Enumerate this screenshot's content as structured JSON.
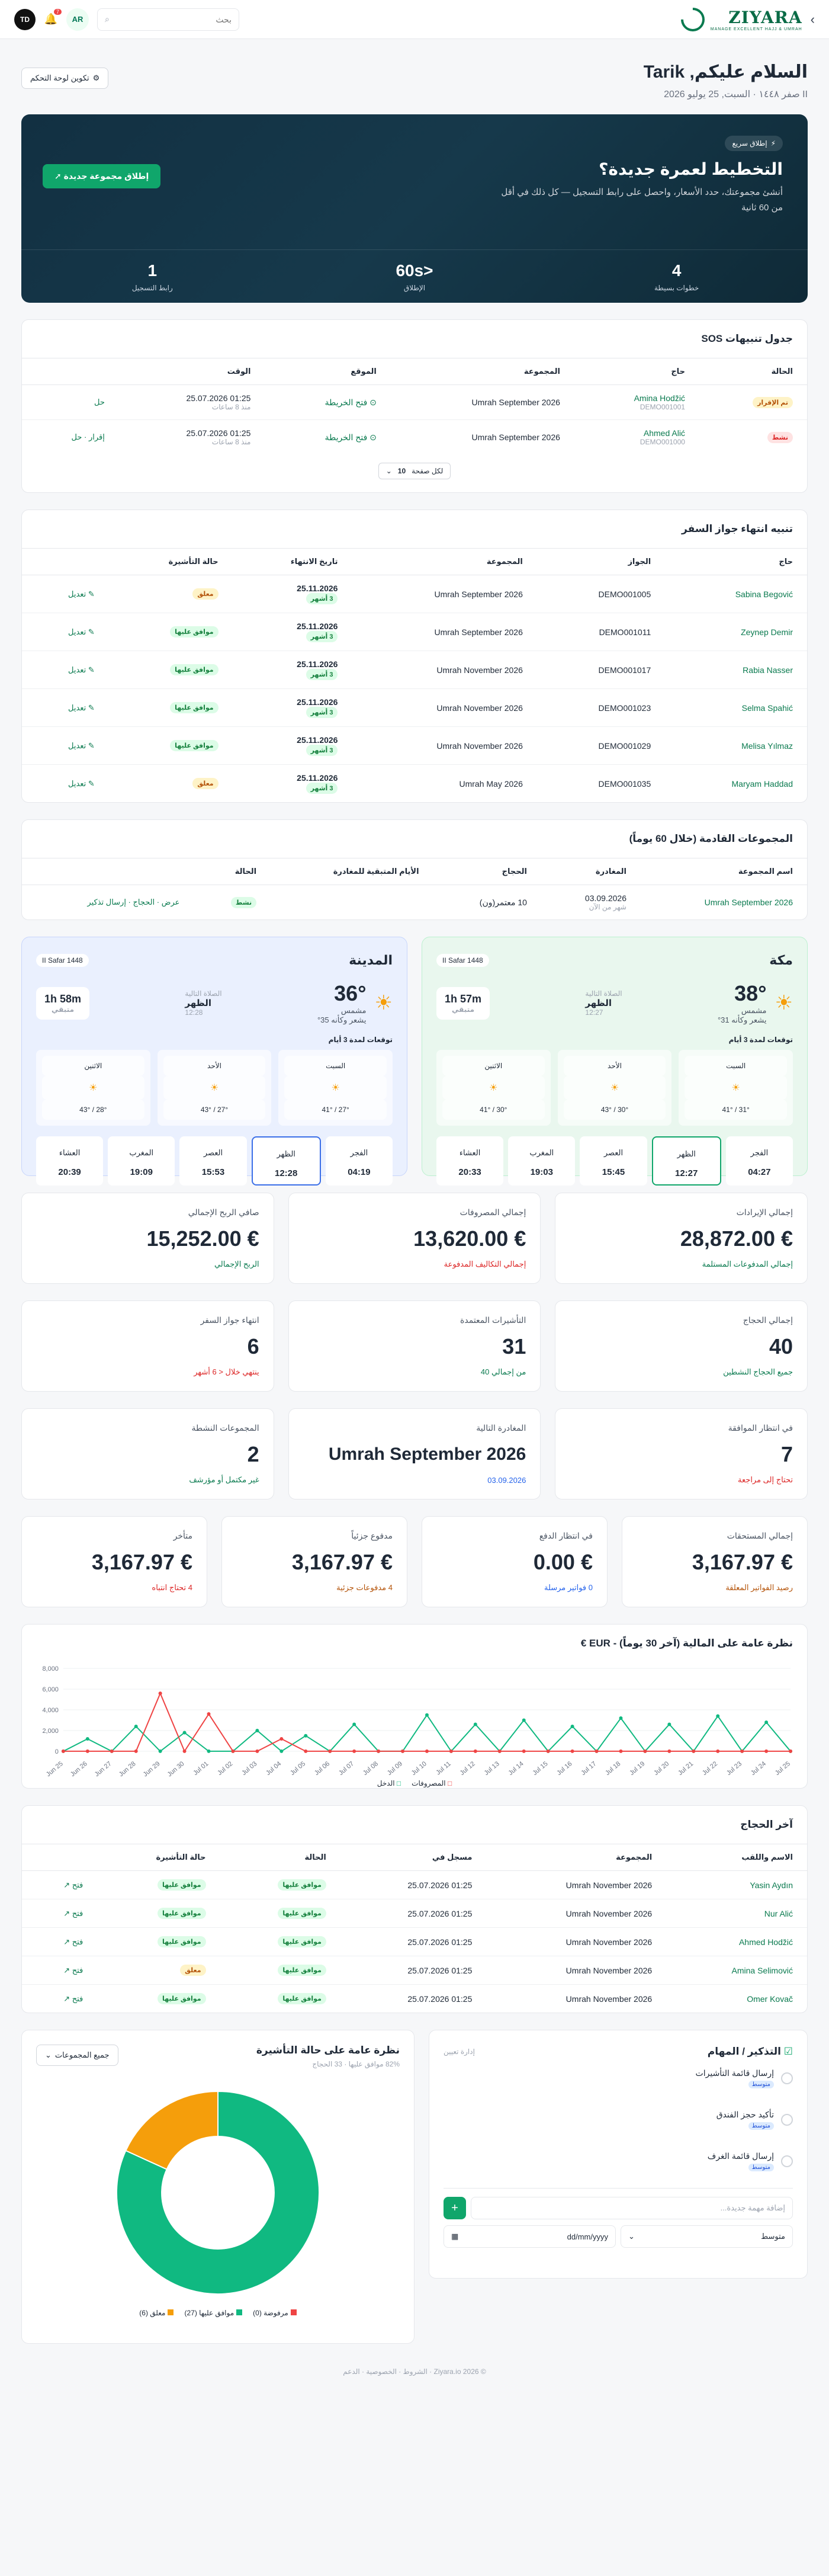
{
  "brand": {
    "name": "ZIYARA",
    "tag": "MANAGE EXCELLENT HAJJ & UMRAH"
  },
  "top": {
    "search_placeholder": "بحث",
    "lang": "AR",
    "notif_count": "7",
    "avatar": "TD"
  },
  "greeting": {
    "title": "السلام عليكم, Tarik",
    "date": "II صفر ١٤٤٨ · السبت, 25 يوليو 2026",
    "configure": "تكوين لوحة التحكم"
  },
  "hero": {
    "pill": "إطلاق سريع",
    "title": "التخطيط لعمرة جديدة؟",
    "desc": "أنشئ مجموعتك، حدد الأسعار، واحصل على رابط التسجيل — كل ذلك في أقل من 60 ثانية",
    "cta": "إطلاق مجموعة جديدة",
    "stats": [
      {
        "v": "4",
        "l": "خطوات بسيطة"
      },
      {
        "v": "<60s",
        "l": "الإطلاق"
      },
      {
        "v": "1",
        "l": "رابط التسجيل"
      }
    ]
  },
  "sos": {
    "title": "جدول تنبيهات SOS",
    "headers": [
      "الحالة",
      "حاج",
      "المجموعة",
      "الموقع",
      "الوقت",
      ""
    ],
    "rows": [
      {
        "status": "تم الإقرار",
        "name": "Amina Hodžić",
        "id": "DEMO001001",
        "group": "Umrah September 2026",
        "loc": "فتح الخريطة",
        "time": "01:25 25.07.2026",
        "ago": "منذ 8 ساعات",
        "action": "حل"
      },
      {
        "status": "نشط",
        "name": "Ahmed Alić",
        "id": "DEMO001000",
        "group": "Umrah September 2026",
        "loc": "فتح الخريطة",
        "time": "01:25 25.07.2026",
        "ago": "منذ 8 ساعات",
        "action": "إقرار · حل"
      }
    ],
    "pager": "لكل صفحة",
    "per": "10"
  },
  "passport": {
    "title": "تنبيه انتهاء جواز السفر",
    "headers": [
      "حاج",
      "الجواز",
      "المجموعة",
      "تاريخ الانتهاء",
      "حالة التأشيرة",
      ""
    ],
    "rows": [
      {
        "name": "Sabina Begović",
        "pass": "DEMO001005",
        "group": "Umrah September 2026",
        "date": "25.11.2026",
        "rem": "3 أشهر",
        "visa": "معلق",
        "vc": "b-y"
      },
      {
        "name": "Zeynep Demir",
        "pass": "DEMO001011",
        "group": "Umrah September 2026",
        "date": "25.11.2026",
        "rem": "3 أشهر",
        "visa": "موافق عليها",
        "vc": "b-g"
      },
      {
        "name": "Rabia Nasser",
        "pass": "DEMO001017",
        "group": "Umrah November 2026",
        "date": "25.11.2026",
        "rem": "3 أشهر",
        "visa": "موافق عليها",
        "vc": "b-g"
      },
      {
        "name": "Selma Spahić",
        "pass": "DEMO001023",
        "group": "Umrah November 2026",
        "date": "25.11.2026",
        "rem": "3 أشهر",
        "visa": "موافق عليها",
        "vc": "b-g"
      },
      {
        "name": "Melisa Yılmaz",
        "pass": "DEMO001029",
        "group": "Umrah November 2026",
        "date": "25.11.2026",
        "rem": "3 أشهر",
        "visa": "موافق عليها",
        "vc": "b-g"
      },
      {
        "name": "Maryam Haddad",
        "pass": "DEMO001035",
        "group": "Umrah May 2026",
        "date": "25.11.2026",
        "rem": "3 أشهر",
        "visa": "معلق",
        "vc": "b-y"
      }
    ],
    "edit": "تعديل"
  },
  "upcoming": {
    "title": "المجموعات القادمة (خلال 60 يوماً)",
    "headers": [
      "اسم المجموعة",
      "المغادرة",
      "الحجاج",
      "الأيام المتبقية للمغادرة",
      "الحالة",
      ""
    ],
    "row": {
      "name": "Umrah September 2026",
      "date": "03.09.2026",
      "ago": "شهر من الآن",
      "pilgrims": "10 معتمر(ون)",
      "days": "",
      "status": "نشط",
      "actions": "عرض · الحجاج · إرسال تذكير"
    }
  },
  "makkah": {
    "city": "مكة",
    "hijri": "II Safar 1448",
    "temp": "38°",
    "cond": "مشمس",
    "feels": "يشعر وكأنه 31°",
    "next_l": "الصلاة التالية",
    "next": "الظهر",
    "next_t": "12:27",
    "cd": "1h 57m",
    "cd_l": "متبقي",
    "fc_h": "توقعات لمدة 3 أيام",
    "fc": [
      {
        "d": "السبت",
        "t": "31° / 41°"
      },
      {
        "d": "الأحد",
        "t": "30° / 43°"
      },
      {
        "d": "الاثنين",
        "t": "30° / 41°"
      }
    ],
    "pt": [
      {
        "n": "الفجر",
        "t": "04:27"
      },
      {
        "n": "الظهر",
        "t": "12:27"
      },
      {
        "n": "العصر",
        "t": "15:45"
      },
      {
        "n": "المغرب",
        "t": "19:03"
      },
      {
        "n": "العشاء",
        "t": "20:33"
      }
    ]
  },
  "madinah": {
    "city": "المدينة",
    "hijri": "II Safar 1448",
    "temp": "36°",
    "cond": "مشمس",
    "feels": "يشعر وكأنه 35°",
    "next_l": "الصلاة التالية",
    "next": "الظهر",
    "next_t": "12:28",
    "cd": "1h 58m",
    "cd_l": "متبقي",
    "fc_h": "توقعات لمدة 3 أيام",
    "fc": [
      {
        "d": "السبت",
        "t": "27° / 41°"
      },
      {
        "d": "الأحد",
        "t": "27° / 43°"
      },
      {
        "d": "الاثنين",
        "t": "28° / 43°"
      }
    ],
    "pt": [
      {
        "n": "الفجر",
        "t": "04:19"
      },
      {
        "n": "الظهر",
        "t": "12:28"
      },
      {
        "n": "العصر",
        "t": "15:53"
      },
      {
        "n": "المغرب",
        "t": "19:09"
      },
      {
        "n": "العشاء",
        "t": "20:39"
      }
    ]
  },
  "stats1": [
    {
      "l": "إجمالي الإيرادات",
      "v": "€ 28,872.00",
      "s": "إجمالي المدفوعات المستلمة",
      "c": "#0a7a4f"
    },
    {
      "l": "إجمالي المصروفات",
      "v": "€ 13,620.00",
      "s": "إجمالي التكاليف المدفوعة",
      "c": "#dc2626"
    },
    {
      "l": "صافي الربح الإجمالي",
      "v": "€ 15,252.00",
      "s": "الربح الإجمالي",
      "c": "#0a7a4f"
    }
  ],
  "stats2": [
    {
      "l": "إجمالي الحجاج",
      "v": "40",
      "s": "جميع الحجاج النشطين",
      "c": "#0a7a4f"
    },
    {
      "l": "التأشيرات المعتمدة",
      "v": "31",
      "s": "من إجمالي 40",
      "c": "#0a7a4f"
    },
    {
      "l": "انتهاء جواز السفر",
      "v": "6",
      "s": "ينتهي خلال < 6 أشهر",
      "c": "#dc2626"
    }
  ],
  "stats3": [
    {
      "l": "في انتظار الموافقة",
      "v": "7",
      "s": "تحتاج إلى مراجعة",
      "c": "#dc2626"
    },
    {
      "l": "المغادرة التالية",
      "v": "Umrah September 2026",
      "s": "03.09.2026",
      "c": "#2563eb"
    },
    {
      "l": "المجموعات النشطة",
      "v": "2",
      "s": "غير مكتمل أو مؤرشف",
      "c": "#0a7a4f"
    }
  ],
  "stats4": [
    {
      "l": "إجمالي المستحقات",
      "v": "€ 3,167.97",
      "s": "رصيد الفواتير المعلقة",
      "c": "#b45309"
    },
    {
      "l": "في انتظار الدفع",
      "v": "€ 0.00",
      "s": "0 فواتير مرسلة",
      "c": "#2563eb"
    },
    {
      "l": "مدفوع جزئياً",
      "v": "€ 3,167.97",
      "s": "4 مدفوعات جزئية",
      "c": "#b45309"
    },
    {
      "l": "متأخر",
      "v": "€ 3,167.97",
      "s": "4 تحتاج انتباه",
      "c": "#dc2626"
    }
  ],
  "finance": {
    "title": "نظرة عامة على المالية (آخر 30 يوماً) - EUR €",
    "legend_in": "الدخل",
    "legend_out": "المصروفات"
  },
  "chart_data": {
    "type": "line",
    "title": "نظرة عامة على المالية (آخر 30 يوماً) - EUR €",
    "x": [
      "Jun 25",
      "Jun 26",
      "Jun 27",
      "Jun 28",
      "Jun 29",
      "Jun 30",
      "Jul 01",
      "Jul 02",
      "Jul 03",
      "Jul 04",
      "Jul 05",
      "Jul 06",
      "Jul 07",
      "Jul 08",
      "Jul 09",
      "Jul 10",
      "Jul 11",
      "Jul 12",
      "Jul 13",
      "Jul 14",
      "Jul 15",
      "Jul 16",
      "Jul 17",
      "Jul 18",
      "Jul 19",
      "Jul 20",
      "Jul 21",
      "Jul 22",
      "Jul 23",
      "Jul 24",
      "Jul 25"
    ],
    "ylim": [
      0,
      8000
    ],
    "yticks": [
      0,
      2000,
      4000,
      6000,
      8000
    ],
    "series": [
      {
        "name": "الدخل",
        "color": "#10b981",
        "values": [
          0,
          1200,
          0,
          2400,
          0,
          1800,
          0,
          0,
          2000,
          0,
          1500,
          0,
          2600,
          0,
          0,
          3500,
          0,
          2600,
          0,
          3000,
          0,
          2400,
          0,
          3200,
          0,
          2600,
          0,
          3400,
          0,
          2800,
          0
        ]
      },
      {
        "name": "المصروفات",
        "color": "#ef4444",
        "values": [
          0,
          0,
          0,
          0,
          5600,
          0,
          3600,
          0,
          0,
          1200,
          0,
          0,
          0,
          0,
          0,
          0,
          0,
          0,
          0,
          0,
          0,
          0,
          0,
          0,
          0,
          0,
          0,
          0,
          0,
          0,
          0
        ]
      }
    ]
  },
  "recent": {
    "title": "آخر الحجاج",
    "headers": [
      "الاسم واللقب",
      "المجموعة",
      "مسجل في",
      "الحالة",
      "حالة التأشيرة",
      ""
    ],
    "rows": [
      {
        "name": "Yasin Aydın",
        "group": "Umrah November 2026",
        "date": "01:25 25.07.2026",
        "st": "موافق عليها",
        "visa": "موافق عليها",
        "vc": "b-g"
      },
      {
        "name": "Nur Alić",
        "group": "Umrah November 2026",
        "date": "01:25 25.07.2026",
        "st": "موافق عليها",
        "visa": "موافق عليها",
        "vc": "b-g"
      },
      {
        "name": "Ahmed Hodžić",
        "group": "Umrah November 2026",
        "date": "01:25 25.07.2026",
        "st": "موافق عليها",
        "visa": "موافق عليها",
        "vc": "b-g"
      },
      {
        "name": "Amina Selimović",
        "group": "Umrah November 2026",
        "date": "01:25 25.07.2026",
        "st": "موافق عليها",
        "visa": "معلق",
        "vc": "b-y"
      },
      {
        "name": "Omer Kovač",
        "group": "Umrah November 2026",
        "date": "01:25 25.07.2026",
        "st": "موافق عليها",
        "visa": "موافق عليها",
        "vc": "b-g"
      }
    ],
    "open": "فتح"
  },
  "todo": {
    "title": "التذكير / المهام",
    "manage": "إدارة تعيين",
    "items": [
      {
        "t": "إرسال قائمة التأشيرات",
        "p": "متوسط"
      },
      {
        "t": "تأكيد حجز الفندق",
        "p": "متوسط"
      },
      {
        "t": "إرسال قائمة الغرف",
        "p": "متوسط"
      }
    ],
    "placeholder": "إضافة مهمة جديدة...",
    "priority": "متوسط",
    "date": "dd/mm/yyyy"
  },
  "visa": {
    "title": "نظرة عامة على حالة التأشيرة",
    "sub": "82% موافق عليها · 33 الحجاج",
    "filter": "جميع المجموعات",
    "slices": [
      {
        "name": "موافق عليها",
        "value": 27,
        "color": "#10b981"
      },
      {
        "name": "معلق",
        "value": 6,
        "color": "#f59e0b"
      },
      {
        "name": "مرفوضة",
        "value": 0,
        "color": "#ef4444"
      }
    ],
    "legend": [
      "مرفوضة (0)",
      "موافق عليها (27)",
      "معلق (6)"
    ]
  },
  "footer": "© 2026 Ziyara.io · الشروط · الخصوصية · الدعم"
}
